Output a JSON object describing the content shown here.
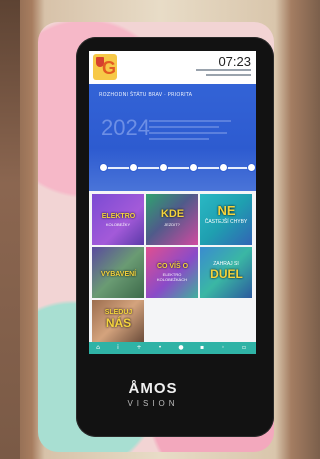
{
  "kiosk": {
    "clock": "07:23",
    "breadcrumb": "ROZHODNI ŠTÁTU BRAV  ·  PRIORITA",
    "year": "2024",
    "brand": "ÅMOS",
    "brand_sub": "VISION"
  },
  "tiles": [
    {
      "label": "ELEKTRO",
      "sub": "KOLOBEŽKY",
      "color": "#f4d33d"
    },
    {
      "label": "KDE",
      "sub": "JEZDIT?",
      "color": "#f4d33d"
    },
    {
      "label": "NE",
      "sub": "ČASTEJŠÍ CHYBY",
      "color": "#f4d33d"
    },
    {
      "label": "VYBAVENÍ",
      "sub": "",
      "color": "#f4d33d"
    },
    {
      "label": "CO VÍŠ O",
      "sub": "ELEKTRO KOLOBEŽKÁCH",
      "color": "#f4d33d"
    },
    {
      "label": "ZAHRAJ SI",
      "sub": "DUEL",
      "color": "#f4d33d"
    },
    {
      "label": "SLEDUJ",
      "sub": "NÁS",
      "color": "#f4d33d"
    }
  ],
  "icons": [
    "home-icon",
    "info-icon",
    "plus-icon",
    "settings-icon",
    "location-icon",
    "grid-icon",
    "accessibility-icon",
    "message-icon"
  ]
}
